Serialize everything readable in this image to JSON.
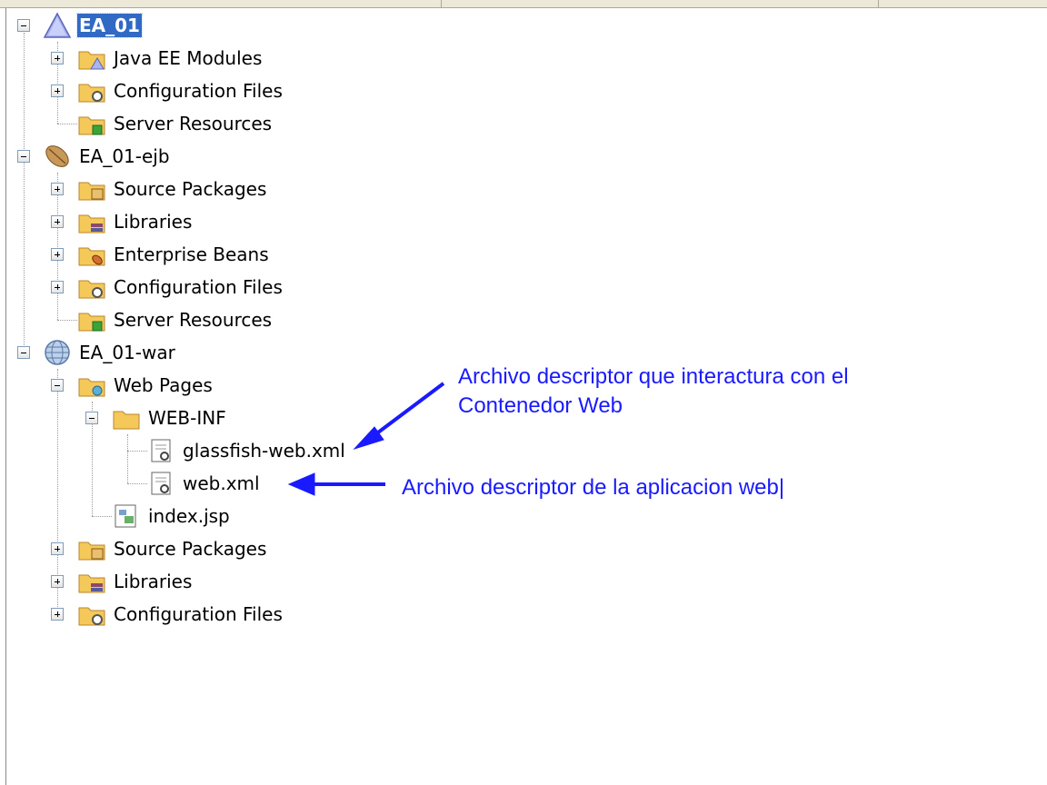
{
  "tree": {
    "root_app": {
      "label": "EA_01",
      "icon": "enterprise-app-icon"
    },
    "app_children": [
      {
        "label": "Java EE Modules",
        "icon": "modules-folder-icon"
      },
      {
        "label": "Configuration Files",
        "icon": "config-folder-icon"
      },
      {
        "label": "Server Resources",
        "icon": "server-resources-folder-icon"
      }
    ],
    "ejb": {
      "label": "EA_01-ejb",
      "icon": "ejb-bean-icon"
    },
    "ejb_children": [
      {
        "label": "Source Packages",
        "icon": "source-packages-folder-icon"
      },
      {
        "label": "Libraries",
        "icon": "libraries-folder-icon"
      },
      {
        "label": "Enterprise Beans",
        "icon": "enterprise-beans-folder-icon"
      },
      {
        "label": "Configuration Files",
        "icon": "config-folder-icon"
      },
      {
        "label": "Server Resources",
        "icon": "server-resources-folder-icon"
      }
    ],
    "war": {
      "label": "EA_01-war",
      "icon": "globe-icon"
    },
    "war_children": {
      "web_pages": "Web Pages",
      "web_inf": "WEB-INF",
      "glassfish": "glassfish-web.xml",
      "webxml": "web.xml",
      "indexjsp": "index.jsp",
      "source_packages": "Source Packages",
      "libraries": "Libraries",
      "configuration_files": "Configuration Files"
    }
  },
  "annotations": {
    "glassfish_line1": "Archivo descriptor que interactura con el",
    "glassfish_line2": "Contenedor Web",
    "webxml": "Archivo descriptor de la aplicacion web|"
  },
  "colors": {
    "annotation": "#1a1aff",
    "selection": "#316ac5",
    "folder": "#f5c85a"
  }
}
